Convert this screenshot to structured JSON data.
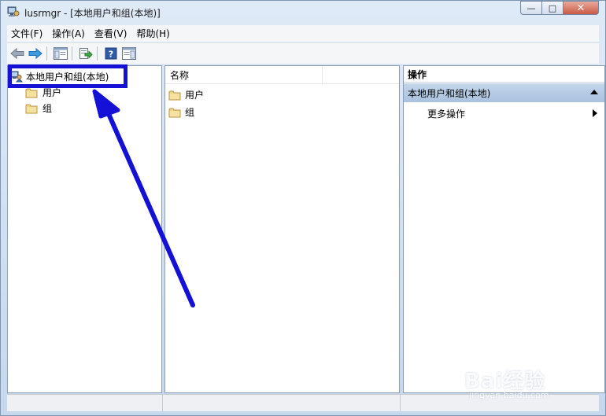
{
  "window": {
    "title": "lusrmgr - [本地用户和组(本地)]",
    "minimize_glyph": "—",
    "maximize_glyph": "□",
    "close_glyph": "✕"
  },
  "menu": {
    "items": [
      {
        "label": "文件(F)"
      },
      {
        "label": "操作(A)"
      },
      {
        "label": "查看(V)"
      },
      {
        "label": "帮助(H)"
      }
    ]
  },
  "toolbar": {
    "icons": [
      "back-arrow-icon",
      "forward-arrow-icon",
      "show-hide-tree-icon",
      "export-list-icon",
      "help-icon",
      "show-hide-action-pane-icon"
    ]
  },
  "tree": {
    "root_label": "本地用户和组(本地)",
    "children": [
      {
        "label": "用户"
      },
      {
        "label": "组"
      }
    ]
  },
  "list": {
    "columns": [
      {
        "label": "名称"
      },
      {
        "label": ""
      }
    ],
    "rows": [
      {
        "label": "用户"
      },
      {
        "label": "组"
      }
    ]
  },
  "actions": {
    "header": "操作",
    "section_title": "本地用户和组(本地)",
    "items": [
      {
        "label": "更多操作"
      }
    ]
  },
  "colors": {
    "annotation": "#1410d6",
    "section_bg": "#b6cce6",
    "folder": "#e8c66a"
  },
  "watermark": {
    "brand": "Bai经验",
    "url": "jingyan.baidu.com"
  }
}
